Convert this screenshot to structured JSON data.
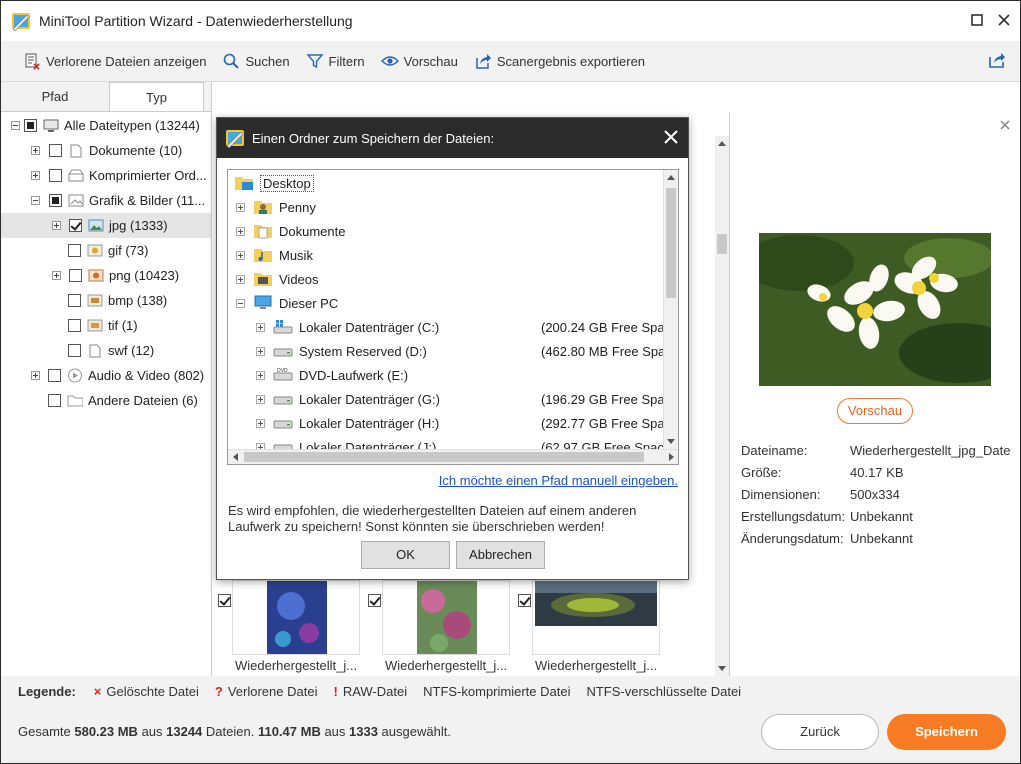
{
  "window": {
    "title": "MiniTool Partition Wizard - Datenwiederherstellung"
  },
  "toolbar": {
    "show_lost": "Verlorene Dateien anzeigen",
    "search": "Suchen",
    "filter": "Filtern",
    "preview": "Vorschau",
    "export": "Scanergebnis exportieren"
  },
  "tabs": [
    {
      "label": "Pfad"
    },
    {
      "label": "Typ"
    }
  ],
  "tree": [
    {
      "label": "Alle Dateitypen (13244)",
      "icon": "computer-icon"
    },
    {
      "label": "Dokumente (10)",
      "icon": "document-icon"
    },
    {
      "label": "Komprimierter Ord...",
      "icon": "archive-icon"
    },
    {
      "label": "Grafik & Bilder (11...",
      "icon": "image-icon"
    },
    {
      "label": "jpg (1333)",
      "icon": "jpg-icon"
    },
    {
      "label": "gif (73)",
      "icon": "gif-icon"
    },
    {
      "label": "png (10423)",
      "icon": "png-icon"
    },
    {
      "label": "bmp (138)",
      "icon": "bmp-icon"
    },
    {
      "label": "tif (1)",
      "icon": "tif-icon"
    },
    {
      "label": "swf (12)",
      "icon": "swf-icon"
    },
    {
      "label": "Audio & Video (802)",
      "icon": "media-icon"
    },
    {
      "label": "Andere Dateien (6)",
      "icon": "folder-icon"
    }
  ],
  "thumbnails": [
    {
      "label": "Wiederhergestellt_j..."
    },
    {
      "label": "Wiederhergestellt_j..."
    },
    {
      "label": "Wiederhergestellt_j..."
    }
  ],
  "preview": {
    "button": "Vorschau",
    "fields": [
      {
        "key": "Dateiname:",
        "value": "Wiederhergestellt_jpg_Date"
      },
      {
        "key": "Größe:",
        "value": "40.17 KB"
      },
      {
        "key": "Dimensionen:",
        "value": "500x334"
      },
      {
        "key": "Erstellungsdatum:",
        "value": "Unbekannt"
      },
      {
        "key": "Änderungsdatum:",
        "value": "Unbekannt"
      }
    ]
  },
  "legend": {
    "title": "Legende:",
    "deleted": "Gelöschte Datei",
    "lost": "Verlorene Datei",
    "raw": "RAW-Datei",
    "ntfs_compressed": "NTFS-komprimierte Datei",
    "ntfs_encrypted": "NTFS-verschlüsselte Datei"
  },
  "footer": {
    "summary_prefix": "Gesamte ",
    "total_size": "580.23 MB",
    "summary_mid1": " aus ",
    "total_files": "13244",
    "summary_mid2": " Dateien.  ",
    "selected_size": "110.47 MB",
    "summary_mid3": " aus ",
    "selected_files": "1333",
    "summary_suffix": " ausgewählt.",
    "back": "Zurück",
    "save": "Speichern"
  },
  "dialog": {
    "title": "Einen Ordner zum Speichern der Dateien:",
    "folders": [
      {
        "label": "Desktop",
        "size": ""
      },
      {
        "label": "Penny",
        "size": ""
      },
      {
        "label": "Dokumente",
        "size": ""
      },
      {
        "label": "Musik",
        "size": ""
      },
      {
        "label": "Videos",
        "size": ""
      },
      {
        "label": "Dieser PC",
        "size": ""
      },
      {
        "label": "Lokaler Datenträger (C:)",
        "size": "(200.24 GB Free Spa"
      },
      {
        "label": "System Reserved (D:)",
        "size": "(462.80 MB Free Spa"
      },
      {
        "label": "DVD-Laufwerk (E:)",
        "size": ""
      },
      {
        "label": "Lokaler Datenträger (G:)",
        "size": "(196.29 GB Free Spa"
      },
      {
        "label": "Lokaler Datenträger (H:)",
        "size": "(292.77 GB Free Spa"
      },
      {
        "label": "Lokaler Datenträger (J:)",
        "size": "(62.97 GB Free Spac"
      }
    ],
    "manual_link": "Ich möchte einen Pfad manuell eingeben.",
    "hint": "Es wird empfohlen, die wiederhergestellten Dateien auf einem anderen Laufwerk zu speichern! Sonst könnten sie überschrieben werden!",
    "ok": "OK",
    "cancel": "Abbrechen"
  },
  "colors": {
    "accent": "#f77b22",
    "link": "#1a56c4",
    "dialog_title_bg": "#2b2b2b"
  }
}
